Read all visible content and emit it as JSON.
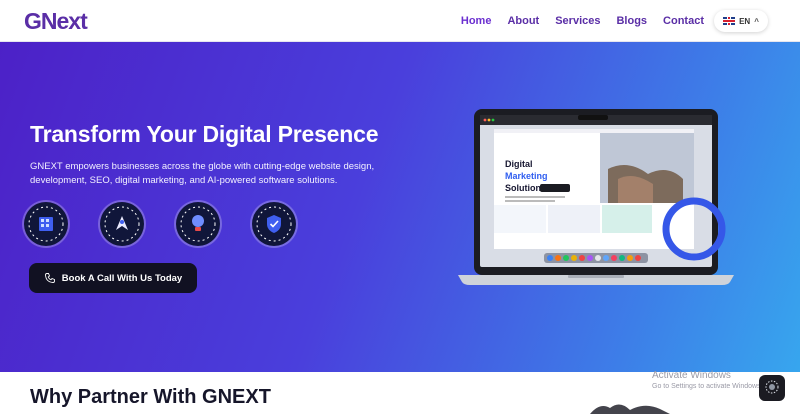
{
  "brand": {
    "logo_text": "GNext",
    "color": "#5a2ea6"
  },
  "nav": {
    "links": [
      {
        "label": "Home",
        "active": true
      },
      {
        "label": "About"
      },
      {
        "label": "Services"
      },
      {
        "label": "Blogs"
      },
      {
        "label": "Contact"
      }
    ],
    "language": {
      "code": "EN",
      "icon": "uk-flag-icon"
    }
  },
  "hero": {
    "title": "Transform Your Digital Presence",
    "subtitle": "GNEXT empowers businesses across the globe with cutting-edge website design, development, SEO, digital marketing, and AI-powered software solutions.",
    "feature_icons": [
      "building-icon",
      "rocket-icon",
      "lightbulb-icon",
      "shield-check-icon"
    ],
    "cta_label": "Book A Call With Us Today",
    "cta_icon": "phone-icon",
    "gradient": [
      "#4c21c7",
      "#37a6ee"
    ]
  },
  "laptop_screen": {
    "headline_1": "Digital",
    "headline_2": "Marketing",
    "headline_3": "Solutions."
  },
  "section": {
    "title": "Why Partner With GNEXT"
  },
  "windows_notice": {
    "line1": "Activate Windows",
    "line2": "Go to Settings to activate Windows."
  }
}
